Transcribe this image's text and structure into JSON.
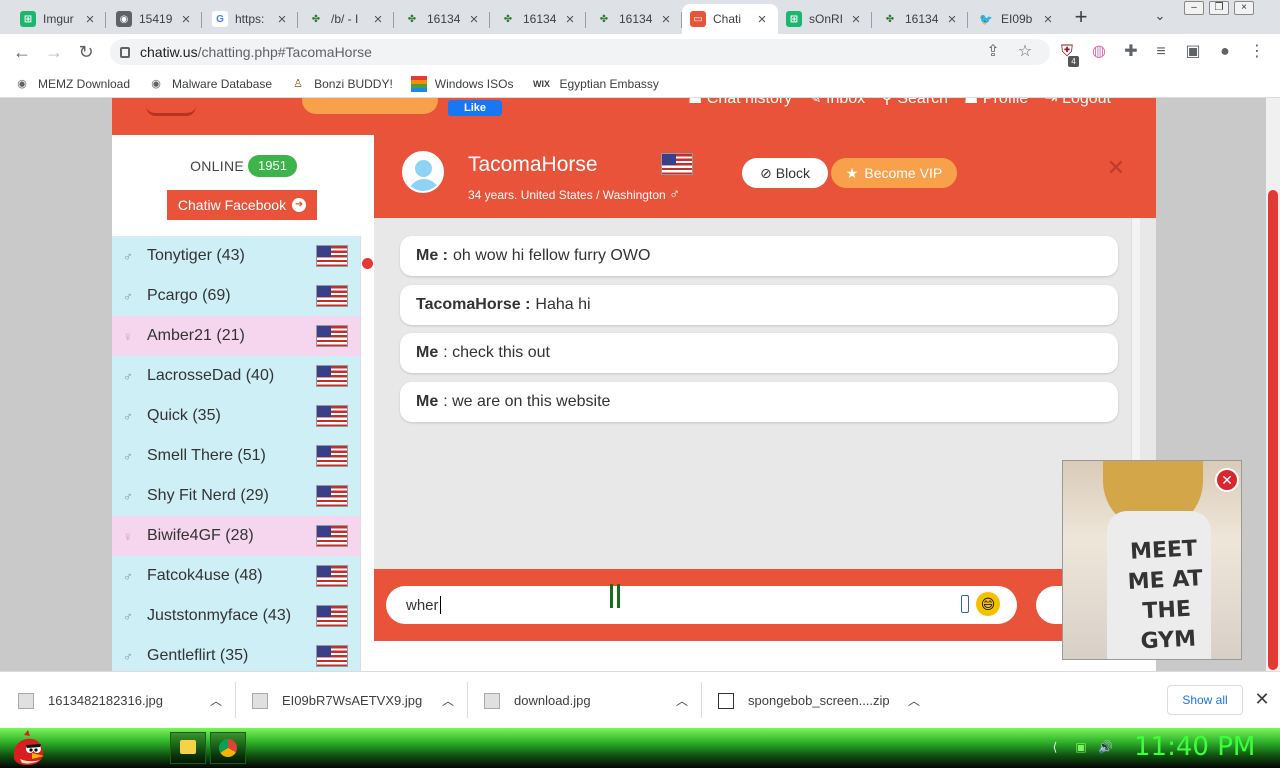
{
  "browser": {
    "tabs": [
      {
        "title": "Imgur",
        "fav_color": "#1bb76e",
        "fav_glyph": "⊞"
      },
      {
        "title": "15419",
        "fav_color": "#5f6368",
        "fav_glyph": "◉"
      },
      {
        "title": "https:",
        "fav_color": "#4285f4",
        "fav_glyph": "G"
      },
      {
        "title": "/b/ - I",
        "fav_color": "#2e7d32",
        "fav_glyph": "✤"
      },
      {
        "title": "16134",
        "fav_color": "#2e7d32",
        "fav_glyph": "✤"
      },
      {
        "title": "16134",
        "fav_color": "#2e7d32",
        "fav_glyph": "✤"
      },
      {
        "title": "16134",
        "fav_color": "#2e7d32",
        "fav_glyph": "✤"
      },
      {
        "title": "Chati",
        "fav_color": "#e8533a",
        "fav_glyph": "▭"
      },
      {
        "title": "sOnRI",
        "fav_color": "#1bb76e",
        "fav_glyph": "⊞"
      },
      {
        "title": "16134",
        "fav_color": "#2e7d32",
        "fav_glyph": "✤"
      },
      {
        "title": "EI09b",
        "fav_color": "#1d9bf0",
        "fav_glyph": "🐦"
      }
    ],
    "url_host": "chatiw.us",
    "url_path": "/chatting.php#TacomaHorse",
    "extension_badge": "4",
    "bookmarks": [
      {
        "label": "MEMZ Download",
        "icon": "globe-icon"
      },
      {
        "label": "Malware Database",
        "icon": "globe-icon"
      },
      {
        "label": "Bonzi BUDDY!",
        "icon": "bonzi-icon"
      },
      {
        "label": "Windows ISOs",
        "icon": "windows-icon"
      },
      {
        "label": "Egyptian Embassy",
        "icon": "wix-icon",
        "glyph": "WIX"
      }
    ]
  },
  "site": {
    "nav_items": [
      "Chat history",
      "Inbox",
      "Search",
      "Profile",
      "Logout"
    ],
    "fb_like": "Like",
    "online_label": "ONLINE",
    "online_count": "1951",
    "fb_button": "Chatiw Facebook",
    "users": [
      {
        "name": "Tonytiger (43)",
        "gender": "male"
      },
      {
        "name": "Pcargo (69)",
        "gender": "male"
      },
      {
        "name": "Amber21 (21)",
        "gender": "female"
      },
      {
        "name": "LacrosseDad (40)",
        "gender": "male"
      },
      {
        "name": "Quick (35)",
        "gender": "male"
      },
      {
        "name": "Smell There (51)",
        "gender": "male"
      },
      {
        "name": "Shy Fit Nerd (29)",
        "gender": "male"
      },
      {
        "name": "Biwife4GF (28)",
        "gender": "female"
      },
      {
        "name": "Fatcok4use (48)",
        "gender": "male"
      },
      {
        "name": "Juststonmyface (43)",
        "gender": "male"
      },
      {
        "name": "Gentleflirt (35)",
        "gender": "male"
      }
    ],
    "chat": {
      "partner_name": "TacomaHorse",
      "partner_info": "34 years. United States / Washington",
      "block_label": "Block",
      "vip_label": "Become VIP",
      "messages": [
        {
          "sender": "Me :",
          "text": "oh wow hi fellow furry OWO"
        },
        {
          "sender": "TacomaHorse :",
          "text": "Haha hi"
        },
        {
          "sender": "Me",
          "text": ": check this out"
        },
        {
          "sender": "Me",
          "text": ": we are on this website"
        }
      ],
      "input_value": "wher"
    },
    "ad_text": "MEET ME AT THE GYM"
  },
  "downloads": {
    "items": [
      {
        "name": "1613482182316.jpg"
      },
      {
        "name": "EI09bR7WsAETVX9.jpg"
      },
      {
        "name": "download.jpg"
      },
      {
        "name": "spongebob_screen....zip"
      }
    ],
    "show_all": "Show all"
  },
  "taskbar": {
    "clock": "11:40 PM"
  },
  "colors": {
    "brand": "#e8533a",
    "online_badge": "#3bb54a",
    "vip": "#f8a04a",
    "clock": "#3cff3c"
  }
}
